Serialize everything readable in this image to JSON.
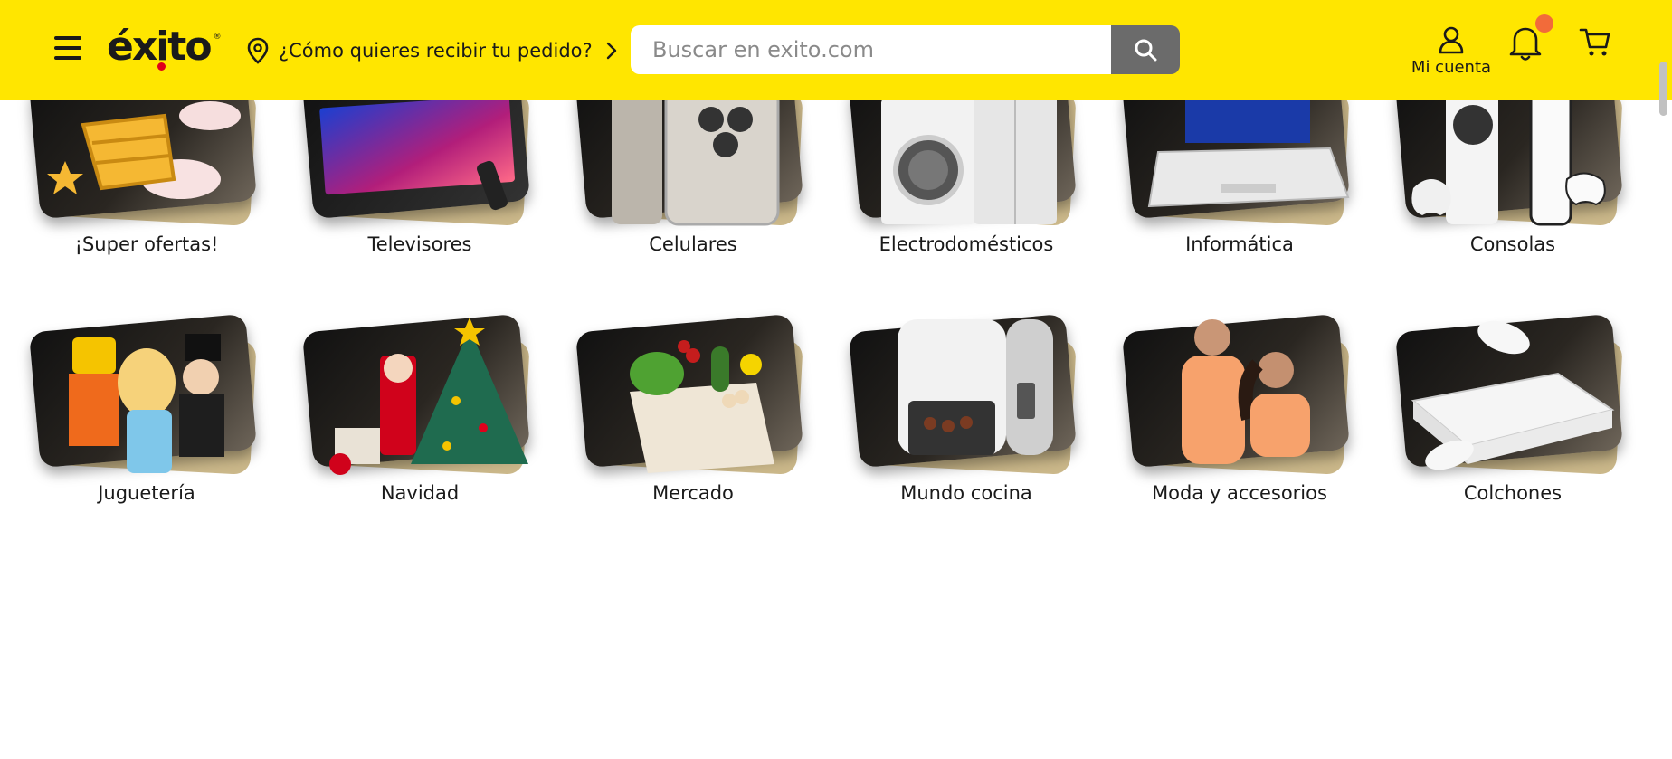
{
  "header": {
    "menu_icon": "hamburger-menu-icon",
    "logo_text": "éxito",
    "delivery_text": "¿Cómo quieres recibir tu pedido?",
    "search_placeholder": "Buscar en exito.com",
    "account_label": "Mi cuenta",
    "colors": {
      "brand_yellow": "#ffe600",
      "search_button": "#6b6b6b",
      "notification": "#f26b3a",
      "logo_dot": "#e0001b"
    }
  },
  "categories": [
    {
      "label": "¡Super ofertas!",
      "icon": "basket-icon"
    },
    {
      "label": "Televisores",
      "icon": "tv-icon"
    },
    {
      "label": "Celulares",
      "icon": "phone-icon"
    },
    {
      "label": "Electrodomésticos",
      "icon": "washer-icon"
    },
    {
      "label": "Informática",
      "icon": "laptop-icon"
    },
    {
      "label": "Consolas",
      "icon": "console-icon"
    },
    {
      "label": "Juguetería",
      "icon": "toys-icon"
    },
    {
      "label": "Navidad",
      "icon": "christmas-tree-icon"
    },
    {
      "label": "Mercado",
      "icon": "grocery-bag-icon"
    },
    {
      "label": "Mundo cocina",
      "icon": "air-fryer-icon"
    },
    {
      "label": "Moda y accesorios",
      "icon": "fashion-icon"
    },
    {
      "label": "Colchones",
      "icon": "mattress-icon"
    }
  ]
}
